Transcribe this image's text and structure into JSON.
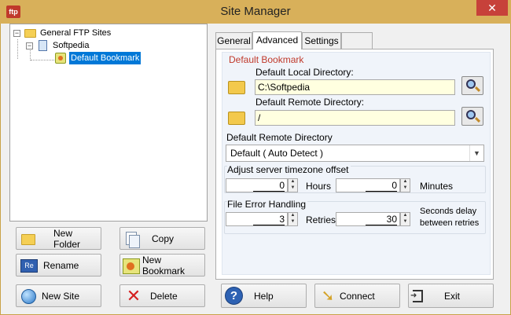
{
  "window": {
    "app_icon_text": "ftp",
    "title": "Site Manager",
    "close_glyph": "✕"
  },
  "tree": {
    "root": {
      "label": "General FTP Sites",
      "expander": "−",
      "icon": "folder-icon"
    },
    "site": {
      "label": "Softpedia",
      "expander": "−",
      "icon": "server-icon"
    },
    "bookmark": {
      "label": "Default Bookmark",
      "icon": "bookmark-icon",
      "selected": true
    }
  },
  "left_buttons": {
    "new_folder": "New Folder",
    "copy": "Copy",
    "rename": "Rename",
    "new_bookmark": "New Bookmark",
    "new_site": "New Site",
    "delete": "Delete"
  },
  "tabs": [
    "General",
    "Advanced",
    "Settings",
    ""
  ],
  "active_tab": "Advanced",
  "advanced": {
    "section_title": "Default Bookmark",
    "local_dir_label": "Default Local Directory:",
    "local_dir_value": "C:\\Softpedia",
    "remote_dir_label": "Default Remote Directory:",
    "remote_dir_value": "/",
    "remote_mode_label": "Default Remote Directory",
    "remote_mode_value": "Default ( Auto Detect )",
    "timezone_label": "Adjust server timezone offset",
    "hours_value": "0",
    "hours_label": "Hours",
    "minutes_value": "0",
    "minutes_label": "Minutes",
    "error_label": "File Error Handling",
    "retries_value": "3",
    "retries_label": "Retries",
    "delay_value": "30",
    "delay_label_line1": "Seconds delay",
    "delay_label_line2": "between retries"
  },
  "bottom_buttons": {
    "help": "Help",
    "connect": "Connect",
    "exit": "Exit"
  },
  "colors": {
    "titlebar": "#d8b05a",
    "close": "#c7413a",
    "selection": "#0078d7",
    "section_title": "#c0392b",
    "field_bg": "#ffffe0"
  }
}
